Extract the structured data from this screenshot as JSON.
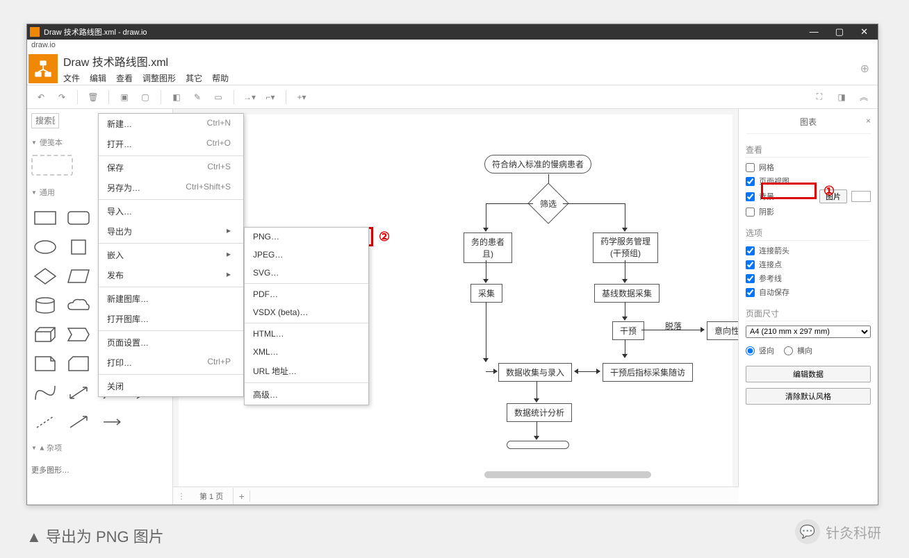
{
  "window": {
    "title": "Draw 技术路线图.xml - draw.io"
  },
  "app_label": "draw.io",
  "filename": "Draw 技术路线图.xml",
  "menubar": [
    "文件",
    "编辑",
    "查看",
    "调整图形",
    "其它",
    "帮助"
  ],
  "search_placeholder": "搜索图",
  "sections": {
    "pencil": "便笺本",
    "common": "通用",
    "misc": "杂项",
    "more": "更多图形…"
  },
  "file_menu": {
    "new": {
      "label": "新建…",
      "shortcut": "Ctrl+N"
    },
    "open": {
      "label": "打开…",
      "shortcut": "Ctrl+O"
    },
    "save": {
      "label": "保存",
      "shortcut": "Ctrl+S"
    },
    "saveas": {
      "label": "另存为…",
      "shortcut": "Ctrl+Shift+S"
    },
    "import": {
      "label": "导入…"
    },
    "export": {
      "label": "导出为"
    },
    "embed": {
      "label": "嵌入"
    },
    "publish": {
      "label": "发布"
    },
    "newlibrary": {
      "label": "新建图库…"
    },
    "openlibrary": {
      "label": "打开图库…"
    },
    "pagesetup": {
      "label": "页面设置…"
    },
    "print": {
      "label": "打印…",
      "shortcut": "Ctrl+P"
    },
    "close": {
      "label": "关闭"
    }
  },
  "export_menu": {
    "png": "PNG…",
    "jpeg": "JPEG…",
    "svg": "SVG…",
    "pdf": "PDF…",
    "vsdx": "VSDX (beta)…",
    "html": "HTML…",
    "xml": "XML…",
    "url": "URL 地址…",
    "advanced": "高级…"
  },
  "flowchart": {
    "n1": "符合纳入标准的慢病患者",
    "n2": "筛选",
    "n3a": "务的患者",
    "n3b": "且)",
    "n4": "药学服务管理\n(干预组)",
    "n5a": "采集",
    "n5b": "基线数据采集",
    "n6": "干预",
    "n6label": "脱落",
    "n7": "意向性分析",
    "n8": "数据收集与录入",
    "n9": "干预后指标采集随访",
    "n10": "数据统计分析"
  },
  "right_panel": {
    "tab": "图表",
    "sec_view": "查看",
    "grid": "网格",
    "pageview": "页面视图",
    "background": "背景",
    "image_btn": "图片",
    "shadow": "阴影",
    "sec_options": "选项",
    "conn_arrow": "连接箭头",
    "conn_point": "连接点",
    "guide": "参考线",
    "autosave": "自动保存",
    "sec_pagesize": "页面尺寸",
    "pagesize_value": "A4 (210 mm x 297 mm)",
    "portrait": "竖向",
    "landscape": "横向",
    "edit_data": "编辑数据",
    "clear_default": "清除默认风格"
  },
  "footer": {
    "page1": "第 1 页"
  },
  "caption": "▲ 导出为 PNG 图片",
  "wechat": "针灸科研",
  "annotations": {
    "one": "①",
    "two": "②"
  }
}
